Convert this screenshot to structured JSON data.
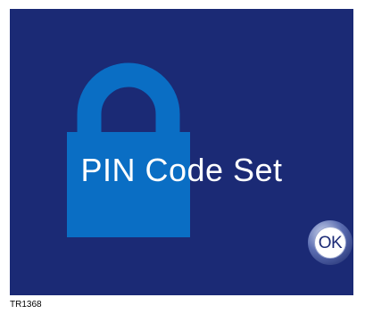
{
  "screen": {
    "message": "PIN Code Set",
    "ok_button_label": "OK",
    "background_color": "#1b2a75",
    "lock_icon_color": "#0a6ec4"
  },
  "figure_reference": "TR1368"
}
